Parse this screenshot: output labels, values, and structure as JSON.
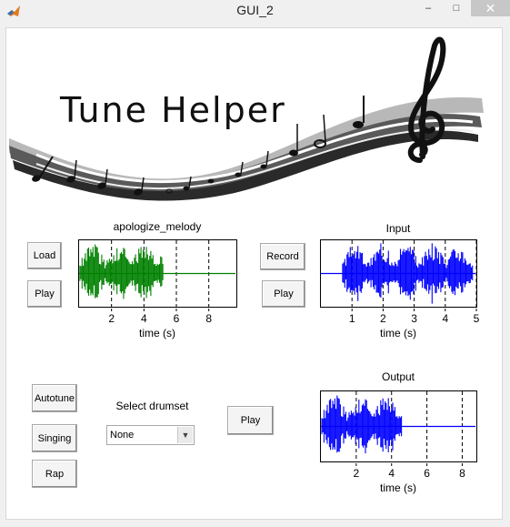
{
  "window": {
    "title": "GUI_2"
  },
  "titlebar_buttons": {
    "minimize": "–",
    "maximize": "□",
    "close": "✕"
  },
  "banner": {
    "text": "Tune Helper"
  },
  "melody_panel": {
    "title": "apologize_melody",
    "load_label": "Load",
    "play_label": "Play",
    "xlabel": "time (s)",
    "ticks": [
      "2",
      "4",
      "6",
      "8"
    ],
    "color": "#008000"
  },
  "input_panel": {
    "title": "Input",
    "record_label": "Record",
    "play_label": "Play",
    "xlabel": "time (s)",
    "ticks": [
      "1",
      "2",
      "3",
      "4",
      "5"
    ],
    "color": "#0000ff"
  },
  "controls": {
    "autotune_label": "Autotune",
    "singing_label": "Singing",
    "rap_label": "Rap",
    "drumset_label": "Select drumset",
    "drumset_value": "None",
    "play_label": "Play"
  },
  "output_panel": {
    "title": "Output",
    "xlabel": "time (s)",
    "ticks": [
      "2",
      "4",
      "6",
      "8"
    ],
    "color": "#0000ff"
  },
  "chart_data": [
    {
      "type": "line",
      "title": "apologize_melody",
      "xlabel": "time (s)",
      "ylabel": "",
      "xlim": [
        0,
        9.7
      ],
      "xticks": [
        2,
        4,
        6,
        8
      ],
      "grid": "x-dashed",
      "signal_end": 5.2,
      "color": "#008000"
    },
    {
      "type": "line",
      "title": "Input",
      "xlabel": "time (s)",
      "ylabel": "",
      "xlim": [
        0,
        5
      ],
      "xticks": [
        1,
        2,
        3,
        4,
        5
      ],
      "grid": "x-dashed",
      "signal_start": 0.7,
      "signal_end": 4.9,
      "color": "#0000ff"
    },
    {
      "type": "line",
      "title": "Output",
      "xlabel": "time (s)",
      "ylabel": "",
      "xlim": [
        0,
        8.8
      ],
      "xticks": [
        2,
        4,
        6,
        8
      ],
      "grid": "x-dashed",
      "signal_end": 4.6,
      "color": "#0000ff"
    }
  ]
}
